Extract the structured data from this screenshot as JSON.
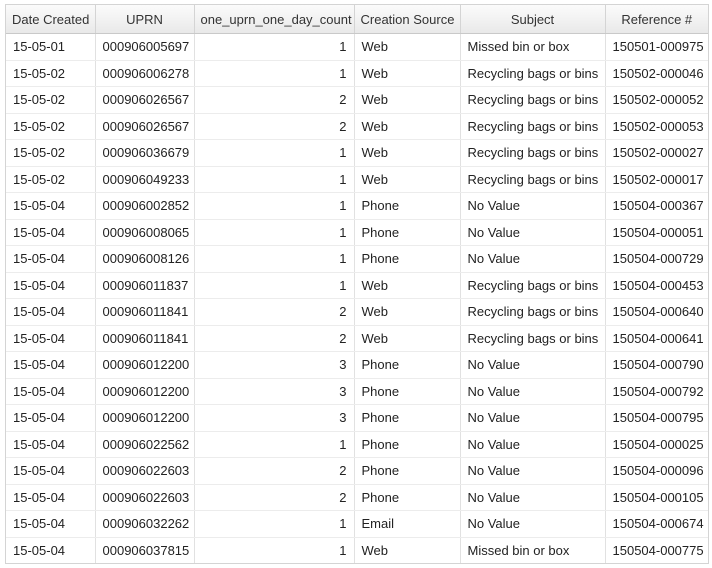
{
  "table": {
    "columns": [
      "Date Created",
      "UPRN",
      "one_uprn_one_day_count",
      "Creation Source",
      "Subject",
      "Reference #"
    ],
    "rows": [
      [
        "15-05-01",
        "000906005697",
        "1",
        "Web",
        "Missed bin or box",
        "150501-000975"
      ],
      [
        "15-05-02",
        "000906006278",
        "1",
        "Web",
        "Recycling bags or bins",
        "150502-000046"
      ],
      [
        "15-05-02",
        "000906026567",
        "2",
        "Web",
        "Recycling bags or bins",
        "150502-000052"
      ],
      [
        "15-05-02",
        "000906026567",
        "2",
        "Web",
        "Recycling bags or bins",
        "150502-000053"
      ],
      [
        "15-05-02",
        "000906036679",
        "1",
        "Web",
        "Recycling bags or bins",
        "150502-000027"
      ],
      [
        "15-05-02",
        "000906049233",
        "1",
        "Web",
        "Recycling bags or bins",
        "150502-000017"
      ],
      [
        "15-05-04",
        "000906002852",
        "1",
        "Phone",
        "No Value",
        "150504-000367"
      ],
      [
        "15-05-04",
        "000906008065",
        "1",
        "Phone",
        "No Value",
        "150504-000051"
      ],
      [
        "15-05-04",
        "000906008126",
        "1",
        "Phone",
        "No Value",
        "150504-000729"
      ],
      [
        "15-05-04",
        "000906011837",
        "1",
        "Web",
        "Recycling bags or bins",
        "150504-000453"
      ],
      [
        "15-05-04",
        "000906011841",
        "2",
        "Web",
        "Recycling bags or bins",
        "150504-000640"
      ],
      [
        "15-05-04",
        "000906011841",
        "2",
        "Web",
        "Recycling bags or bins",
        "150504-000641"
      ],
      [
        "15-05-04",
        "000906012200",
        "3",
        "Phone",
        "No Value",
        "150504-000790"
      ],
      [
        "15-05-04",
        "000906012200",
        "3",
        "Phone",
        "No Value",
        "150504-000792"
      ],
      [
        "15-05-04",
        "000906012200",
        "3",
        "Phone",
        "No Value",
        "150504-000795"
      ],
      [
        "15-05-04",
        "000906022562",
        "1",
        "Phone",
        "No Value",
        "150504-000025"
      ],
      [
        "15-05-04",
        "000906022603",
        "2",
        "Phone",
        "No Value",
        "150504-000096"
      ],
      [
        "15-05-04",
        "000906022603",
        "2",
        "Phone",
        "No Value",
        "150504-000105"
      ],
      [
        "15-05-04",
        "000906032262",
        "1",
        "Email",
        "No Value",
        "150504-000674"
      ],
      [
        "15-05-04",
        "000906037815",
        "1",
        "Web",
        "Missed bin or box",
        "150504-000775"
      ]
    ]
  },
  "colors": {
    "header_top": "#fbfbfb",
    "header_bottom": "#e9e9e9",
    "grid_line": "#d4d4d4",
    "text": "#222222"
  }
}
